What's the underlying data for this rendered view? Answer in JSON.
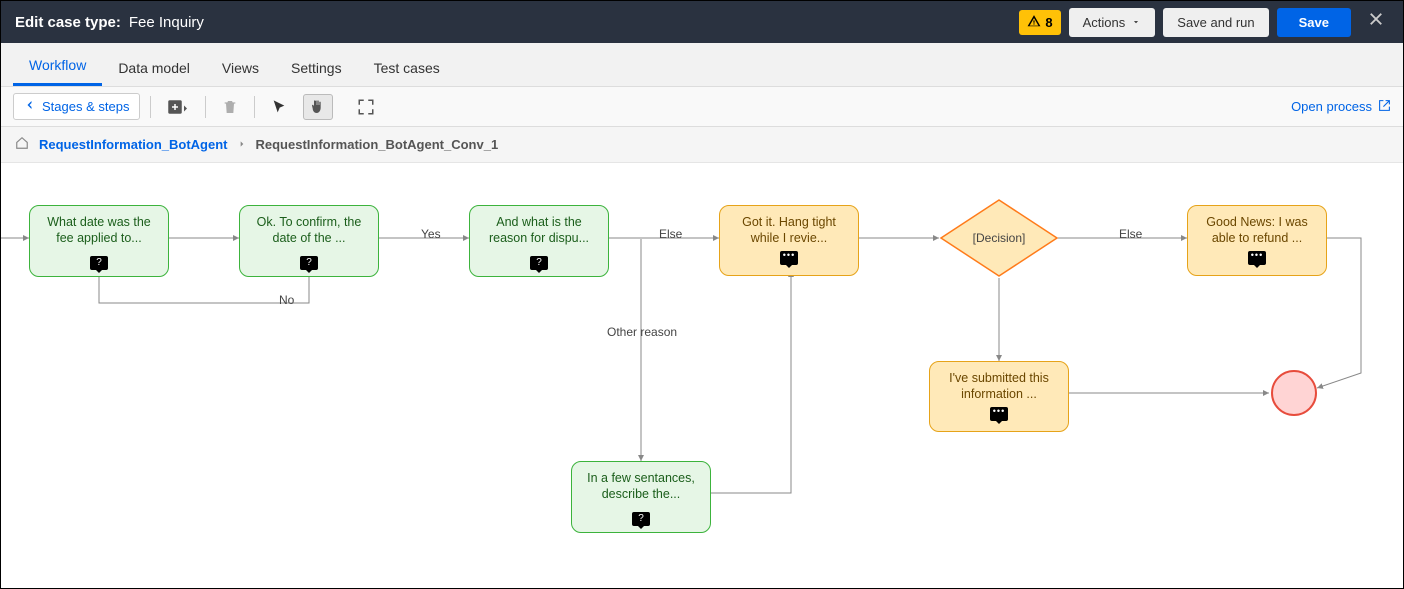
{
  "header": {
    "label": "Edit case type:",
    "title": "Fee Inquiry",
    "warning_count": "8",
    "actions_label": "Actions",
    "save_run_label": "Save and run",
    "save_label": "Save"
  },
  "tabs": {
    "workflow": "Workflow",
    "data_model": "Data model",
    "views": "Views",
    "settings": "Settings",
    "test_cases": "Test cases"
  },
  "toolbar": {
    "stages_steps": "Stages & steps",
    "open_process": "Open process"
  },
  "breadcrumb": {
    "link": "RequestInformation_BotAgent",
    "current": "RequestInformation_BotAgent_Conv_1"
  },
  "nodes": {
    "n1": "What date was the fee applied to...",
    "n2": "Ok. To confirm, the date of the ...",
    "n3": "And what is the reason for dispu...",
    "n4": "Got it. Hang tight while I revie...",
    "decision": "[Decision]",
    "n5": "Good News: I was able to refund ...",
    "n6": "I've submitted this information ...",
    "n7": "In a few sentances, describe the..."
  },
  "edges": {
    "yes": "Yes",
    "no": "No",
    "else1": "Else",
    "other_reason": "Other reason",
    "else2": "Else"
  }
}
